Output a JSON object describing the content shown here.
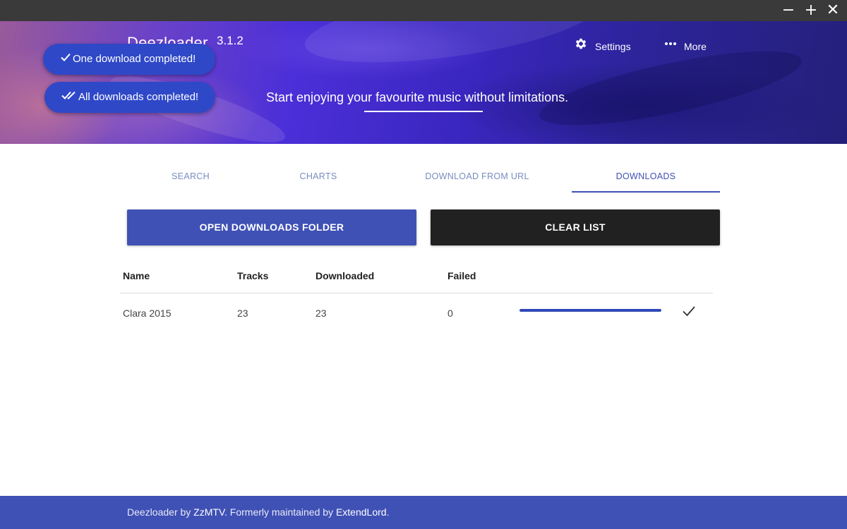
{
  "window": {
    "minimize_label": "−",
    "maximize_label": "+",
    "close_label": "✕"
  },
  "header": {
    "app_name": "Deezloader",
    "version": "3.1.2",
    "tagline": "Start enjoying your favourite music without limitations.",
    "settings_label": "Settings",
    "settings_icon": "gear-icon",
    "more_label": "More",
    "more_icon": "more-horizontal-icon"
  },
  "toasts": [
    {
      "label": "One download completed!",
      "icon": "check-icon"
    },
    {
      "label": "All downloads completed!",
      "icon": "double-check-icon"
    }
  ],
  "tabs": [
    {
      "label": "SEARCH",
      "active": false
    },
    {
      "label": "CHARTS",
      "active": false
    },
    {
      "label": "DOWNLOAD FROM URL",
      "active": false
    },
    {
      "label": "DOWNLOADS",
      "active": true
    }
  ],
  "actions": {
    "open_folder_label": "OPEN DOWNLOADS FOLDER",
    "clear_list_label": "CLEAR LIST"
  },
  "table": {
    "columns": [
      "Name",
      "Tracks",
      "Downloaded",
      "Failed"
    ],
    "rows": [
      {
        "name": "Clara 2015",
        "tracks": "23",
        "downloaded": "23",
        "failed": "0",
        "progress": 1.0,
        "status_icon": "check-icon"
      }
    ]
  },
  "footer": {
    "prefix": "Deezloader by ",
    "author": "ZzMTV",
    "middle": ". Formerly maintained by ",
    "maintainer": "ExtendLord",
    "suffix": "."
  },
  "colors": {
    "primary": "#3f51b5",
    "dark_button": "#212121",
    "toast": "#2f48c8"
  }
}
